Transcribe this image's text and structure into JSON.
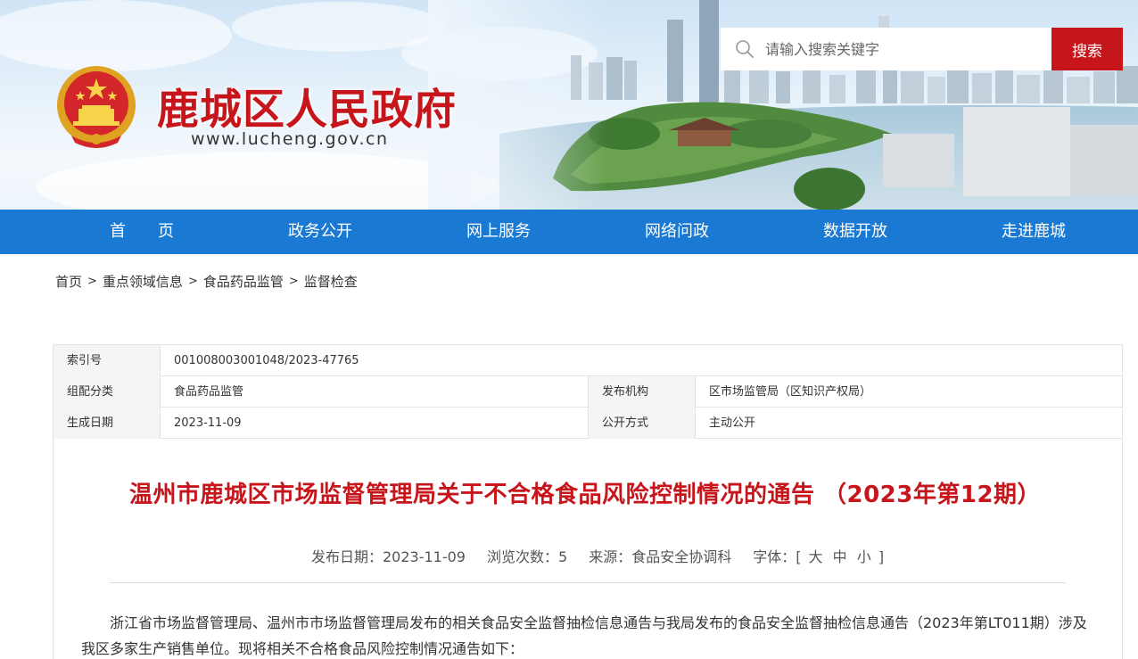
{
  "header": {
    "site_title": "鹿城区人民政府",
    "site_url": "www.lucheng.gov.cn",
    "search": {
      "placeholder": "请输入搜索关键字",
      "button_label": "搜索",
      "icon": "search-icon"
    },
    "emblem_icon": "national-emblem-icon"
  },
  "nav": {
    "items": [
      {
        "label": "首　　页"
      },
      {
        "label": "政务公开"
      },
      {
        "label": "网上服务"
      },
      {
        "label": "网络问政"
      },
      {
        "label": "数据开放"
      },
      {
        "label": "走进鹿城"
      }
    ]
  },
  "breadcrumb": {
    "items": [
      "首页",
      "重点领域信息",
      "食品药品监管",
      "监督检查"
    ],
    "separator": ">"
  },
  "meta": {
    "index_label": "索引号",
    "index_value": "001008003001048/2023-47765",
    "category_label": "组配分类",
    "category_value": "食品药品监管",
    "publisher_label": "发布机构",
    "publisher_value": "区市场监管局（区知识产权局）",
    "date_label": "生成日期",
    "date_value": "2023-11-09",
    "disclosure_label": "公开方式",
    "disclosure_value": "主动公开"
  },
  "article": {
    "title": "温州市鹿城区市场监督管理局关于不合格食品风险控制情况的通告 （2023年第12期）",
    "publish_date": "发布日期：2023-11-09",
    "views": "浏览次数：5",
    "source": "来源：食品安全协调科",
    "font_label": "字体：[",
    "font_large": "大",
    "font_medium": "中",
    "font_small": "小",
    "font_close": "]",
    "body": "浙江省市场监督管理局、温州市市场监督管理局发布的相关食品安全监督抽检信息通告与我局发布的食品安全监督抽检信息通告（2023年第LT011期）涉及我区多家生产销售单位。现将相关不合格食品风险控制情况通告如下："
  },
  "colors": {
    "brand_red": "#c6161c",
    "nav_blue": "#1a7ad3"
  }
}
